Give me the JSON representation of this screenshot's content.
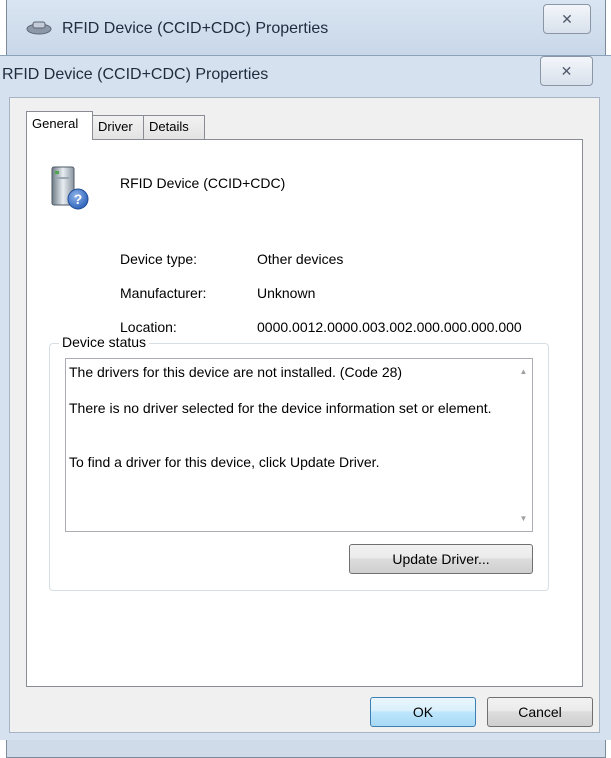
{
  "background_window": {
    "title": "RFID Device (CCID+CDC) Properties",
    "close_glyph": "✕"
  },
  "dialog": {
    "title": "RFID Device (CCID+CDC) Properties",
    "close_glyph": "✕",
    "tabs": [
      {
        "label": "General",
        "active": true
      },
      {
        "label": "Driver",
        "active": false
      },
      {
        "label": "Details",
        "active": false
      }
    ],
    "device": {
      "icon": "unknown-device-icon",
      "name": "RFID Device (CCID+CDC)",
      "properties": [
        {
          "label": "Device type:",
          "value": "Other devices"
        },
        {
          "label": "Manufacturer:",
          "value": "Unknown"
        },
        {
          "label": "Location:",
          "value": "0000.0012.0000.003.002.000.000.000.000"
        }
      ]
    },
    "status_group": {
      "label": "Device status",
      "text": "The drivers for this device are not installed. (Code 28)\n\nThere is no driver selected for the device information set or element.\n\n\nTo find a driver for this device, click Update Driver.",
      "update_button": "Update Driver..."
    },
    "buttons": {
      "ok": "OK",
      "cancel": "Cancel"
    }
  }
}
